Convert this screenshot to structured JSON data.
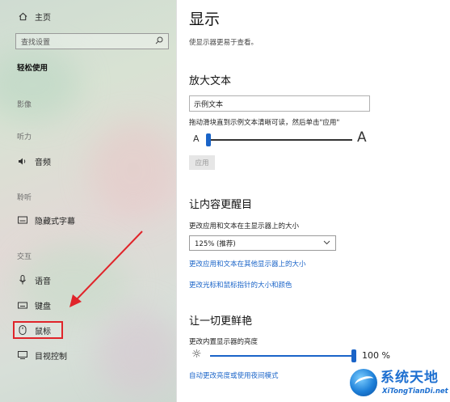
{
  "sidebar": {
    "home_label": "主页",
    "search_placeholder": "查找设置",
    "section_title": "轻松使用",
    "categories": {
      "vision": "影像",
      "hearing": "听力",
      "hearing2": "聆听",
      "interaction": "交互"
    },
    "items": {
      "audio": "音频",
      "captions": "隐藏式字幕",
      "speech": "语音",
      "keyboard": "键盘",
      "mouse": "鼠标",
      "eye_control": "目视控制"
    },
    "highlight_color": "#e0242a"
  },
  "main": {
    "title": "显示",
    "subtitle": "使显示器更易于查看。",
    "enlarge_text": {
      "heading": "放大文本",
      "sample_value": "示例文本",
      "instruction": "拖动滑块直到示例文本清晰可读，然后单击\"应用\"",
      "small_a": "A",
      "big_a": "A",
      "slider_value_fraction": 0.0,
      "apply_label": "应用"
    },
    "make_bigger": {
      "heading": "让内容更醒目",
      "size_label": "更改应用和文本在主显示器上的大小",
      "size_value": "125% (推荐)",
      "link_other_displays": "更改应用和文本在其他显示器上的大小",
      "link_cursor": "更改光标和鼠标指针的大小和颜色"
    },
    "brighter": {
      "heading": "让一切更鲜艳",
      "brightness_label": "更改内置显示器的亮度",
      "brightness_value": "100 %",
      "brightness_fraction": 1.0,
      "link_night_light": "自动更改亮度或使用夜间模式"
    },
    "accent_color": "#1a64c8"
  },
  "watermark": {
    "text_cn": "系统天地",
    "text_en": "XiTongTianDi.net"
  }
}
